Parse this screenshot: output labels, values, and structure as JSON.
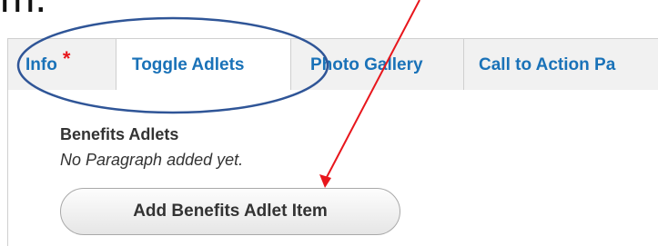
{
  "doc": {
    "fragment": "m."
  },
  "tabs": [
    {
      "label": "Info",
      "required": "*"
    },
    {
      "label": "Toggle Adlets"
    },
    {
      "label": "Photo Gallery"
    },
    {
      "label": "Call to Action Pa"
    }
  ],
  "field": {
    "label": "Benefits Adlets",
    "empty_text": "No Paragraph added yet.",
    "add_button_label": "Add Benefits Adlet Item"
  },
  "annotation": {
    "color": "#e8161c",
    "ellipse_color": "#2f5597"
  },
  "colors": {
    "tab_link": "#1a72b8",
    "tab_bar_bg": "#f1f1f1",
    "required": "#e8161c"
  }
}
